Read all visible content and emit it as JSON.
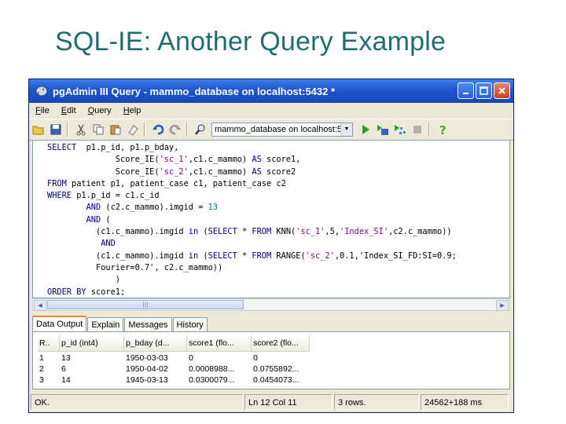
{
  "slide": {
    "title": "SQL-IE: Another Query Example"
  },
  "window": {
    "title": "pgAdmin III Query - mammo_database on localhost:5432 *",
    "colors": {
      "titlebar": "#1f55d0",
      "chrome": "#ece9d8",
      "tab_accent": "#e68b2c"
    }
  },
  "menu": {
    "items": [
      "File",
      "Edit",
      "Query",
      "Help"
    ]
  },
  "toolbar": {
    "icons": [
      "open-icon",
      "save-icon",
      "cut-icon",
      "copy-icon",
      "paste-icon",
      "clear-icon",
      "undo-icon",
      "redo-icon",
      "find-icon",
      "execute-icon",
      "execute-to-file-icon",
      "explain-icon",
      "cancel-icon",
      "help-icon"
    ],
    "database_select": "mammo_database on localhost:5"
  },
  "editor": {
    "lines": [
      "SELECT  p1.p_id, p1.p_bday,",
      "              Score_IE('sc_1',c1.c_mammo) AS score1,",
      "              Score_IE('sc_2',c1.c_mammo) AS score2",
      "FROM patient p1, patient_case c1, patient_case c2",
      "WHERE p1.p_id = c1.c_id",
      "        AND (c2.c_mammo).imgid = 13",
      "        AND (",
      "          (c1.c_mammo).imgid in (SELECT * FROM KNN('sc_1',5,'Index_SI',c2.c_mammo))",
      "           AND",
      "          (c1.c_mammo).imgid in (SELECT * FROM RANGE('sc_2',0.1,'Index_SI_FD:SI=0.9;",
      "          Fourier=0.7', c2.c_mammo))",
      "              )",
      "ORDER BY score1;"
    ]
  },
  "tabs": [
    "Data Output",
    "Explain",
    "Messages",
    "History"
  ],
  "results": {
    "columns": [
      "R..",
      "p_id (int4)",
      "p_bday (d...",
      "score1 (flo...",
      "score2 (flo..."
    ],
    "rows": [
      [
        "1",
        "13",
        "1950-03-03",
        "0",
        "0"
      ],
      [
        "2",
        "6",
        "1950-04-02",
        "0.0008988...",
        "0.0755892..."
      ],
      [
        "3",
        "14",
        "1945-03-13",
        "0.0300079...",
        "0.0454073..."
      ]
    ]
  },
  "status": {
    "message": "OK.",
    "position": "Ln 12 Col 11",
    "rows": "3 rows.",
    "timing": "24562+188 ms"
  }
}
